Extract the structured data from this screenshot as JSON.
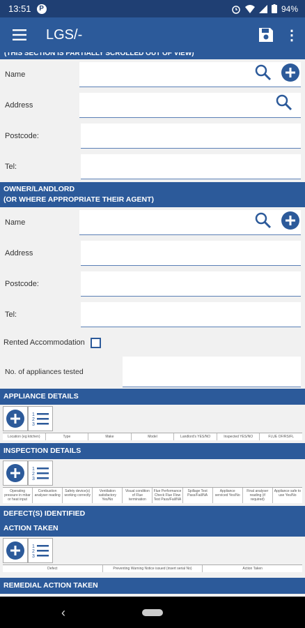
{
  "status": {
    "time": "13:51",
    "battery": "94%"
  },
  "app": {
    "title": "LGS/-"
  },
  "sections": {
    "top_partial_header": "(THIS SECTION IS PARTIALLY SCROLLED OUT OF VIEW)",
    "owner_header_line1": "OWNER/LANDLORD",
    "owner_header_line2": "(OR WHERE APPROPRIATE THEIR AGENT)",
    "appliance": "APPLIANCE DETAILS",
    "inspection": "INSPECTION DETAILS",
    "defects": "DEFECT(S) IDENTIFIED",
    "action": "ACTION TAKEN",
    "remedial": "REMEDIAL ACTION TAKEN"
  },
  "fields": {
    "name": "Name",
    "address": "Address",
    "postcode": "Postcode:",
    "tel": "Tel:",
    "rented": "Rented Accommodation",
    "appliances_tested": "No. of appliances tested"
  },
  "appliance_cols": [
    "Location (eg kitchen)",
    "Type",
    "Make",
    "Model",
    "Landlord's YES/NO",
    "Inspected YES/NO",
    "FLUE OF/RS/FL"
  ],
  "inspection_cols": [
    "Operating pressure in mbar or heat input",
    "Combustion analyser reading",
    "Safety device(s) working correctly",
    "Ventilation satisfactory Yes/No",
    "Visual condition of Flue termination",
    "Flue Performance Check Flue Flow Test Pass/Fail/NA",
    "Spillage Test Pass/Fail/NA",
    "Appliance serviced Yes/No",
    "Final analyser reading (if required)",
    "Appliance safe to use Yes/No"
  ],
  "defect_cols": [
    "Defect",
    "Preventing Warning Notice issued (insert serial No)",
    "Action Taken"
  ]
}
